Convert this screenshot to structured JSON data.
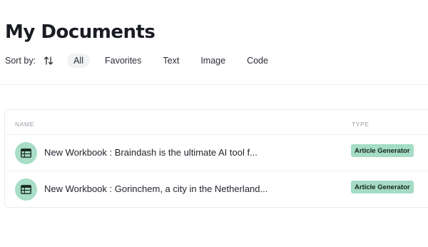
{
  "page": {
    "title": "My Documents"
  },
  "filters": {
    "sort_label": "Sort by:",
    "sort_icon": "sort-arrows-icon",
    "chips": [
      {
        "label": "All",
        "active": true
      },
      {
        "label": "Favorites",
        "active": false
      },
      {
        "label": "Text",
        "active": false
      },
      {
        "label": "Image",
        "active": false
      },
      {
        "label": "Code",
        "active": false
      }
    ]
  },
  "table": {
    "columns": {
      "name": "NAME",
      "type": "TYPE"
    },
    "rows": [
      {
        "icon": "table-icon",
        "name": "New Workbook : Braindash is the ultimate AI tool f...",
        "type": "Article Generator"
      },
      {
        "icon": "table-icon",
        "name": "New Workbook : Gorinchem, a city in the Netherland...",
        "type": "Article Generator"
      }
    ]
  },
  "colors": {
    "accent": "#a8ddc7",
    "badge": "#a5dcc6",
    "chip_active": "#f1f2f4"
  }
}
